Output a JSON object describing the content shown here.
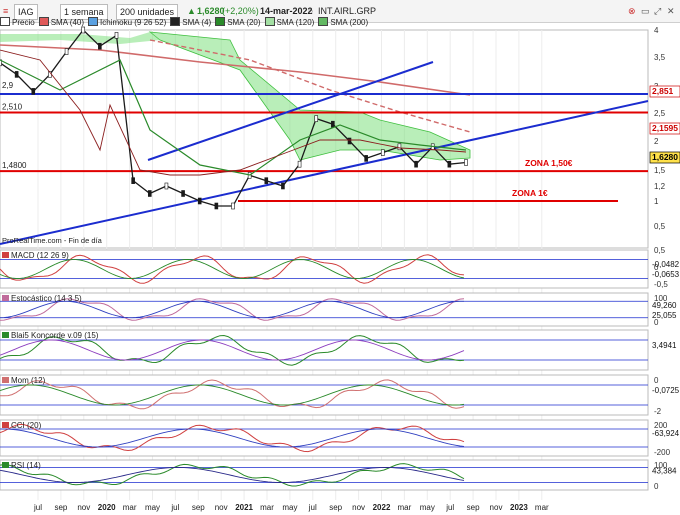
{
  "toolbar": {
    "symbol": "IAG",
    "period": "1 semana",
    "units": "200 unidades",
    "price": "1,6280",
    "change": "(+2,20%)",
    "date": "14-mar-2022",
    "ticker": "INT.AIRL.GRP"
  },
  "legend": [
    {
      "label": "Precio",
      "color": "#ffffff"
    },
    {
      "label": "SMA (40)",
      "color": "#e05a5a"
    },
    {
      "label": "Ichimoku (9 26 52)",
      "color": "#5aa0e0"
    },
    {
      "label": "SMA (4)",
      "color": "#222222"
    },
    {
      "label": "SMA (20)",
      "color": "#2a8a2a"
    },
    {
      "label": "SMA (120)",
      "color": "#a4e0a4"
    },
    {
      "label": "SMA (200)",
      "color": "#62b862"
    }
  ],
  "colors": {
    "blue_line": "#1b2ccf",
    "red_line": "#e00000",
    "cloud": "#7fe07f",
    "cloud_edge": "#3fbf3f",
    "sma200": "#d06a6a",
    "price_label": "#ffe14a"
  },
  "chart_data": {
    "type": "line",
    "price_axis": {
      "ticks": [
        "4",
        "3,5",
        "3",
        "2,5",
        "2",
        "1,5",
        "1,2",
        "1",
        "0,5"
      ],
      "level_labels": [
        "2,510",
        "1,4800",
        "2,9"
      ],
      "right_labels": [
        "2,851",
        "2,1595",
        "1,6280"
      ]
    },
    "x_axis": {
      "labels": [
        "jul",
        "sep",
        "nov",
        "2020",
        "mar",
        "may",
        "jul",
        "sep",
        "nov",
        "2021",
        "mar",
        "may",
        "jul",
        "sep",
        "nov",
        "2022",
        "mar",
        "may",
        "jul",
        "sep",
        "nov",
        "2023",
        "mar"
      ]
    },
    "annotations": [
      "ZONA 1,50€",
      "ZONA 1€"
    ],
    "source": "ProRealTime.com - Fin de día",
    "horizontal_levels": [
      2.851,
      2.51,
      1.48,
      1.0
    ],
    "series": [
      {
        "name": "Precio",
        "values": [
          3.4,
          3.2,
          2.9,
          3.2,
          3.6,
          4.0,
          3.7,
          3.9,
          1.3,
          1.1,
          1.2,
          1.1,
          1.0,
          0.9,
          0.9,
          1.4,
          1.3,
          1.2,
          1.6,
          2.4,
          2.3,
          2.0,
          1.7,
          1.8,
          1.9,
          1.6,
          1.9,
          1.6,
          1.63
        ]
      }
    ]
  },
  "panels": [
    {
      "title": "MACD (12 26 9)",
      "ticks": [
        "0,5",
        "0",
        "-0,5"
      ],
      "values": [
        "-0,0482",
        "-0,0653"
      ]
    },
    {
      "title": "Estocástico (14 3 5)",
      "ticks": [
        "100",
        "0"
      ],
      "values": [
        "49,260",
        "25,055"
      ]
    },
    {
      "title": "Blai5 Koncorde v.09 (15)",
      "ticks": [],
      "values": [
        "3,4941"
      ]
    },
    {
      "title": "Mom (12)",
      "ticks": [
        "0",
        "-2"
      ],
      "values": [
        "-0,0725"
      ]
    },
    {
      "title": "CCI (20)",
      "ticks": [
        "200",
        "-200"
      ],
      "values": [
        "-63,924"
      ]
    },
    {
      "title": "RSI (14)",
      "ticks": [
        "100",
        "0"
      ],
      "values": [
        "43,384"
      ]
    }
  ]
}
